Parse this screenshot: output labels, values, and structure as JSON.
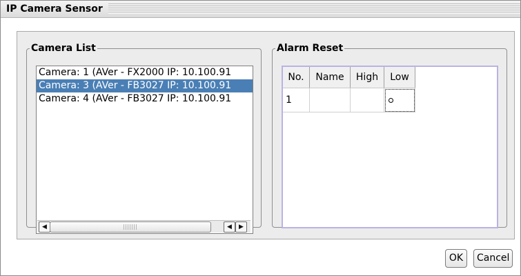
{
  "window": {
    "title": "IP Camera Sensor"
  },
  "camera_list": {
    "legend": "Camera List",
    "items": [
      {
        "label": "Camera: 1 (AVer - FX2000 IP: 10.100.91",
        "selected": false
      },
      {
        "label": "Camera: 3 (AVer - FB3027 IP: 10.100.91",
        "selected": true
      },
      {
        "label": "Camera: 4 (AVer - FB3027 IP: 10.100.91",
        "selected": false
      }
    ]
  },
  "alarm_reset": {
    "legend": "Alarm Reset",
    "columns": [
      "No.",
      "Name",
      "High",
      "Low"
    ],
    "rows": [
      {
        "no": "1",
        "name": "",
        "high": "",
        "low_state": "radio-unchecked"
      }
    ]
  },
  "buttons": {
    "ok": "OK",
    "cancel": "Cancel"
  },
  "colors": {
    "selection": "#4a7fb5",
    "table_border": "#b9b2e4"
  }
}
